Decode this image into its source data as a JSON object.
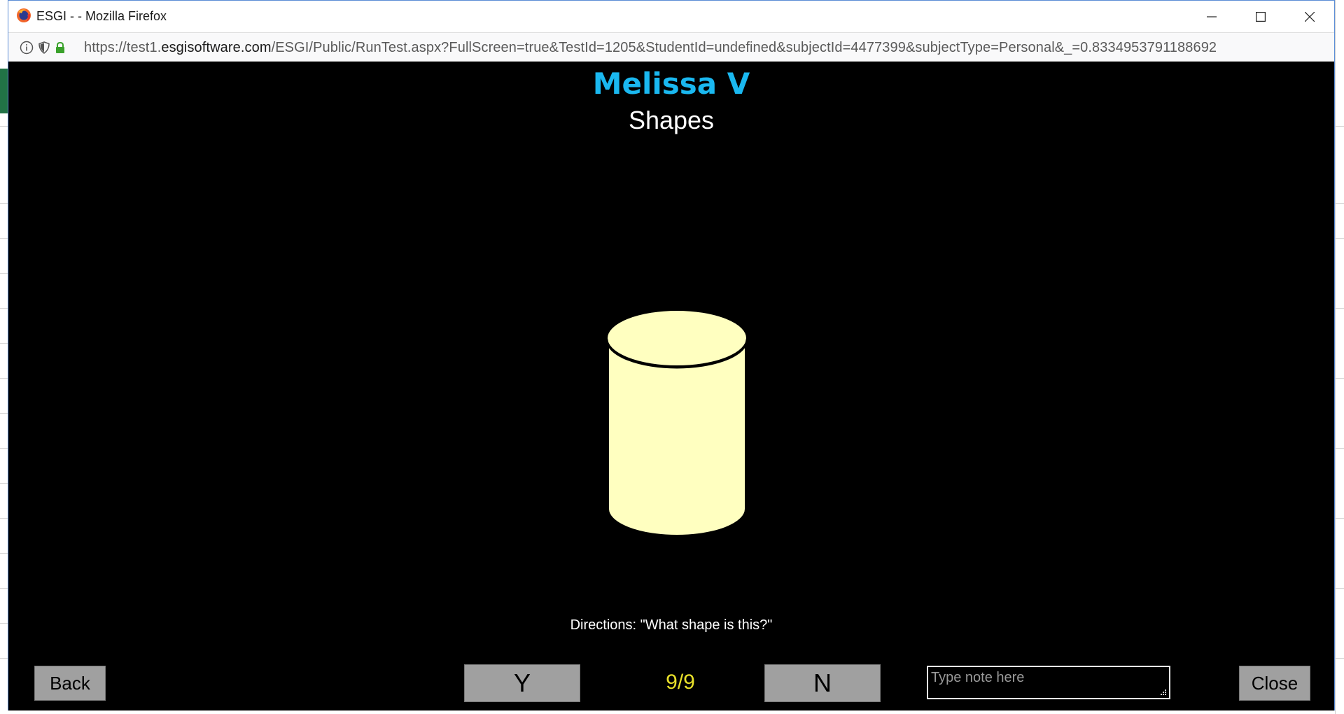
{
  "window": {
    "title": "ESGI - - Mozilla Firefox",
    "url_prefix": "https://test1.",
    "url_domain": "esgisoftware.com",
    "url_path": "/ESGI/Public/RunTest.aspx?FullScreen=true&TestId=1205&StudentId=undefined&subjectId=4477399&subjectType=Personal&_=0.8334953791188692"
  },
  "test": {
    "student_name": "Melissa V",
    "test_name": "Shapes",
    "directions": "Directions: \"What shape is this?\"",
    "shape_icon": "cylinder-icon",
    "shape_fill": "#ffffc0",
    "progress": "9/9"
  },
  "controls": {
    "back_label": "Back",
    "yes_label": "Y",
    "no_label": "N",
    "close_label": "Close",
    "note_placeholder": "Type note here",
    "note_value": ""
  },
  "colors": {
    "student_name": "#1ab8f0",
    "progress": "#e8e02a",
    "button_bg": "#a0a0a0",
    "content_bg": "#000000"
  }
}
